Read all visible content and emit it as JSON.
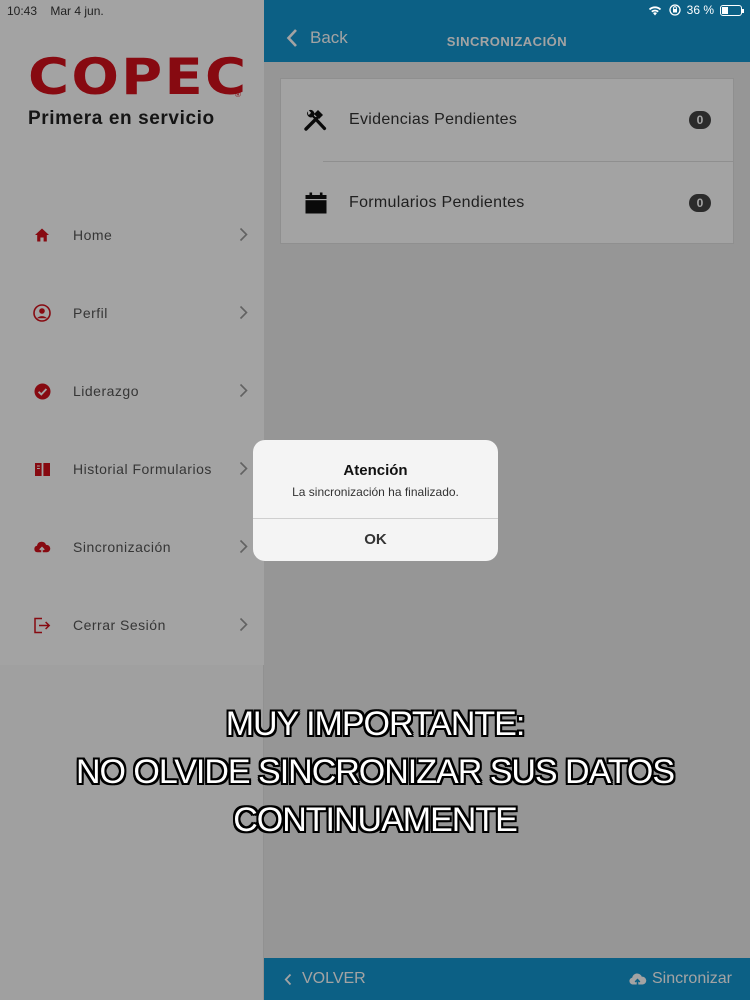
{
  "status": {
    "time": "10:43",
    "date": "Mar 4 jun.",
    "battery": "36 %",
    "battery_level": 0.36
  },
  "brand": {
    "logo_text": "COPEC",
    "registered": "®",
    "tagline": "Primera en servicio",
    "color": "#d4111b"
  },
  "sidebar": {
    "items": [
      {
        "label": "Home",
        "icon": "home-icon"
      },
      {
        "label": "Perfil",
        "icon": "user-circle-icon"
      },
      {
        "label": "Liderazgo",
        "icon": "check-circle-icon"
      },
      {
        "label": "Historial Formularios",
        "icon": "book-icon"
      },
      {
        "label": "Sincronización",
        "icon": "cloud-upload-icon"
      },
      {
        "label": "Cerrar Sesión",
        "icon": "logout-icon"
      }
    ]
  },
  "header": {
    "back_label": "Back",
    "title": "SINCRONIZACIÓN",
    "color": "#1396d0"
  },
  "list": {
    "rows": [
      {
        "label": "Evidencias Pendientes",
        "count": "0",
        "icon": "tools-icon"
      },
      {
        "label": "Formularios Pendientes",
        "count": "0",
        "icon": "calendar-icon"
      }
    ]
  },
  "footer": {
    "back_label": "VOLVER",
    "sync_label": "Sincronizar"
  },
  "alert": {
    "title": "Atención",
    "message": "La sincronización ha finalizado.",
    "ok_label": "OK"
  },
  "caption": {
    "lines": [
      "MUY IMPORTANTE:",
      "NO OLVIDE SINCRONIZAR SUS DATOS",
      "CONTINUAMENTE"
    ]
  }
}
